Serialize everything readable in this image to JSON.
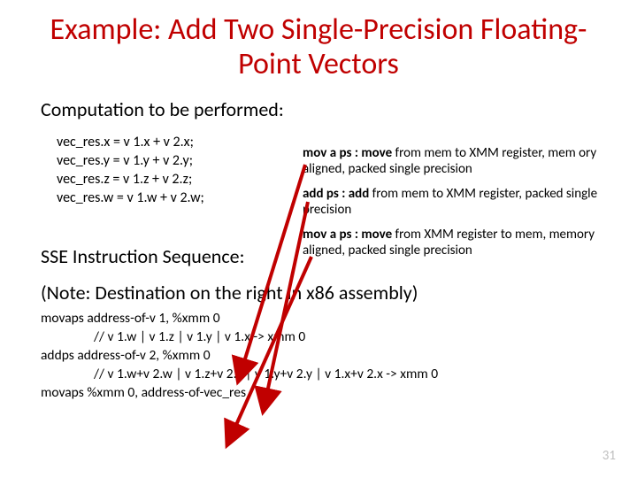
{
  "slide": {
    "title": "Example: Add Two Single-Precision Floating-Point Vectors",
    "subhead": "Computation to be performed:",
    "code": {
      "l1": "vec_res.x = v 1.x  + v 2.x;",
      "l2": "vec_res.y = v 1.y  + v 2.y;",
      "l3": "vec_res.z = v 1.z  + v 2.z;",
      "l4": "vec_res.w = v 1.w + v 2.w;"
    },
    "defs": {
      "d1a": "mov a  ps :  move",
      "d1b": " from mem to XMM register, mem ory aligned, packed single precision",
      "d2a": "add  ps :  add",
      "d2b": " from mem to XMM register, packed single precision",
      "d3a": "mov  a  ps :  move",
      "d3b": " from XMM register to mem, memory aligned, packed single precision"
    },
    "seq_label": "SSE Instruction Sequence:",
    "note": "(Note: Destination on the right in x86 assembly)",
    "asm": {
      "l1": "movaps address-of-v 1, %xmm 0",
      "c1": "// v 1.w | v 1.z | v 1.y | v 1.x -> xmm 0",
      "l2": "addps address-of-v 2, %xmm 0",
      "c2": "// v 1.w+v 2.w | v 1.z+v 2.z | v 1.y+v 2.y | v 1.x+v 2.x -> xmm 0",
      "l3": "movaps %xmm 0, address-of-vec_res"
    },
    "pagenum": "31"
  }
}
